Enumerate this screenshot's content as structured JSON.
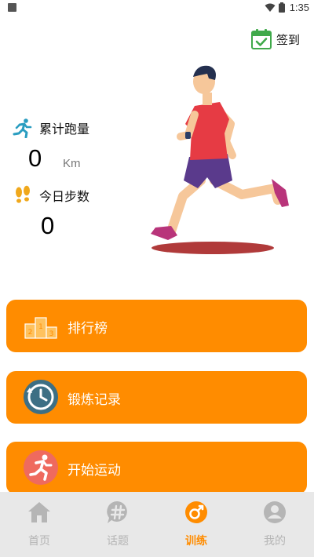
{
  "status_bar": {
    "time": "1:35"
  },
  "checkin": {
    "label": "签到"
  },
  "stats": {
    "total_distance": {
      "title": "累计跑量",
      "value": "0",
      "unit": "Km"
    },
    "today_steps": {
      "title": "今日步数",
      "value": "0"
    }
  },
  "menu": [
    {
      "label": "排行榜",
      "icon": "podium-icon"
    },
    {
      "label": "锻炼记录",
      "icon": "history-clock-icon"
    },
    {
      "label": "开始运动",
      "icon": "runner-icon"
    }
  ],
  "tabs": [
    {
      "label": "首页",
      "icon": "home-icon",
      "active": false
    },
    {
      "label": "话题",
      "icon": "topic-hashtag-icon",
      "active": false
    },
    {
      "label": "训练",
      "icon": "training-icon",
      "active": true
    },
    {
      "label": "我的",
      "icon": "profile-icon",
      "active": false
    }
  ],
  "colors": {
    "accent": "#ff8c00",
    "tab_inactive": "#b5b5b5",
    "tab_bar_bg": "#e8e8e8"
  }
}
